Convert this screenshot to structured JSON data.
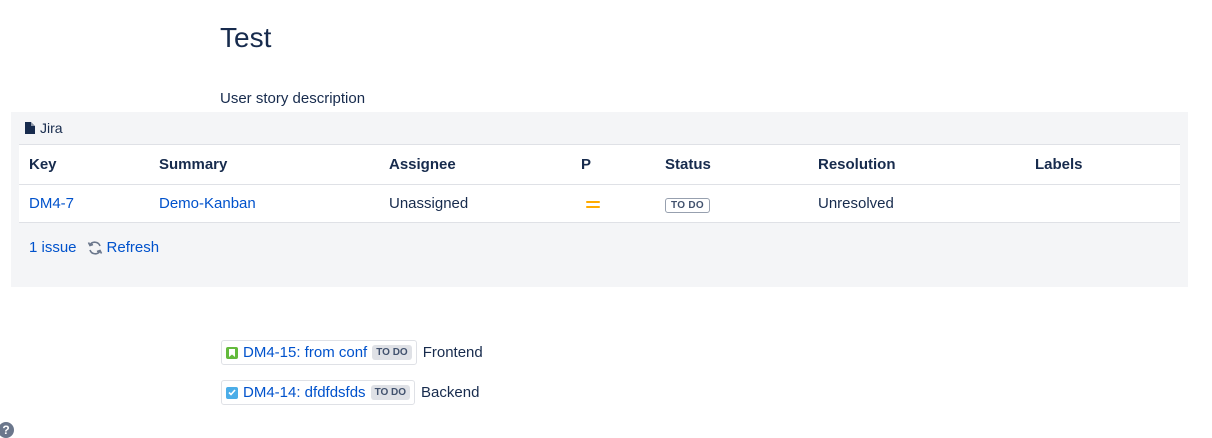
{
  "page": {
    "title": "Test",
    "description": "User story description"
  },
  "jira_macro": {
    "header_label": "Jira",
    "columns": [
      "Key",
      "Summary",
      "Assignee",
      "P",
      "Status",
      "Resolution",
      "Labels"
    ],
    "rows": [
      {
        "key": "DM4-7",
        "summary": "Demo-Kanban",
        "assignee": "Unassigned",
        "priority_icon": "priority-medium-icon",
        "status": "TO DO",
        "resolution": "Unresolved",
        "labels": ""
      }
    ],
    "footer": {
      "count_label": "1 issue",
      "refresh_label": "Refresh"
    }
  },
  "inline_issues": [
    {
      "type_icon": "story-icon",
      "link": "DM4-15: from conf",
      "status": "TO DO",
      "trailing_text": "Frontend"
    },
    {
      "type_icon": "task-icon",
      "link": "DM4-14: dfdfdsfds",
      "status": "TO DO",
      "trailing_text": "Backend"
    }
  ],
  "colors": {
    "link": "#0052cc",
    "text": "#172b4d",
    "macro_bg": "#f4f5f7",
    "priority_medium": "#ffab00",
    "story": "#63ba3c",
    "task": "#4bade8"
  }
}
